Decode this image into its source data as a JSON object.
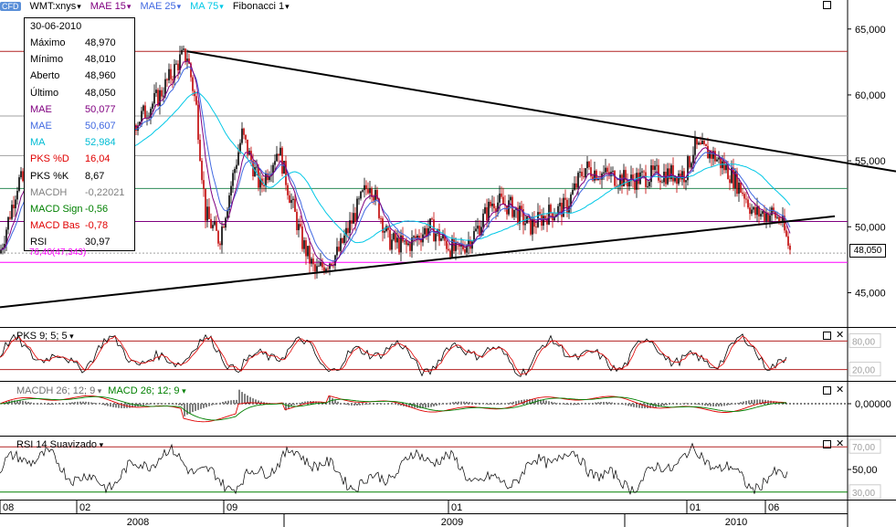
{
  "header": {
    "logo": "CFD",
    "symbol": "WMT:xnys",
    "indicators": [
      {
        "label": "MAE 15",
        "color": "#800080"
      },
      {
        "label": "MAE 25",
        "color": "#4169e1"
      },
      {
        "label": "MA 75",
        "color": "#00c8e6"
      },
      {
        "label": "Fibonacci 1",
        "color": "#000000"
      }
    ]
  },
  "info_box": {
    "date": "30-06-2010",
    "rows": [
      {
        "key": "Máximo",
        "value": "48,970",
        "color": "#000000"
      },
      {
        "key": "Mínimo",
        "value": "48,010",
        "color": "#000000"
      },
      {
        "key": "Aberto",
        "value": "48,960",
        "color": "#000000"
      },
      {
        "key": "Último",
        "value": "48,050",
        "color": "#000000"
      },
      {
        "key": "MAE",
        "value": "50,077",
        "color": "#800080"
      },
      {
        "key": "MAE",
        "value": "50,607",
        "color": "#4169e1"
      },
      {
        "key": "MA",
        "value": "52,984",
        "color": "#00bcd4"
      },
      {
        "key": "PKS %D",
        "value": "16,04",
        "color": "#e00000"
      },
      {
        "key": "PKS %K",
        "value": "8,67",
        "color": "#000000"
      },
      {
        "key": "MACDH",
        "value": "-0,22021",
        "color": "#808080"
      },
      {
        "key": "MACD Sign",
        "value": "-0,56",
        "color": "#008000"
      },
      {
        "key": "MACD Bas",
        "value": "-0,78",
        "color": "#e00000"
      },
      {
        "key": "RSI",
        "value": "30,97",
        "color": "#000000"
      }
    ]
  },
  "fib_label": "76,40(47,343)",
  "price_badge": "48,050",
  "panels": {
    "stoch_title": "PKS 9; 5; 5",
    "macdh_title": "MACDH 26; 12; 9",
    "macd_title": "MACD 26; 12; 9",
    "rsi_title": "RSI 14 Suavizado"
  },
  "chart_data": [
    {
      "type": "candlestick",
      "title": "WMT:xnys",
      "y_ticks": [
        "65,000",
        "60,000",
        "55,000",
        "50,000",
        "45,000"
      ],
      "ylim": [
        42.4,
        67.2
      ],
      "x_month_ticks": [
        "08",
        "02",
        "09",
        "01",
        "01",
        "06"
      ],
      "x_year_labels": [
        "2008",
        "2009",
        "2010"
      ],
      "last_price": 48.05,
      "horizontal_levels": [
        {
          "value": 63.3,
          "color": "#b22222"
        },
        {
          "value": 58.4,
          "color": "#a0a0a0"
        },
        {
          "value": 55.4,
          "color": "#a0a0a0"
        },
        {
          "value": 52.9,
          "color": "#2e8b57"
        },
        {
          "value": 50.4,
          "color": "#800080"
        },
        {
          "value": 48.0,
          "color": "#a0a0a0"
        },
        {
          "value": 47.3,
          "color": "#ff00ff"
        }
      ],
      "trendlines": [
        {
          "from": [
            205,
            63.3
          ],
          "to": [
            981,
            54.2
          ]
        },
        {
          "from": [
            0,
            43.9
          ],
          "to": [
            914,
            50.8
          ]
        }
      ]
    },
    {
      "type": "line",
      "title": "PKS 9; 5; 5",
      "y_ticks": [
        "80,00",
        "20,00"
      ],
      "ylim": [
        0,
        100
      ],
      "levels": [
        80,
        20
      ]
    },
    {
      "type": "bar",
      "title": "MACDH 26; 12; 9",
      "y_ticks": [
        "0,00000"
      ],
      "zero_line": 0
    },
    {
      "type": "line",
      "title": "RSI 14 Suavizado",
      "y_ticks": [
        "70,00",
        "50,00",
        "30,00"
      ],
      "ylim": [
        25,
        75
      ],
      "levels": [
        70,
        30
      ]
    }
  ],
  "colors": {
    "up": "#000000",
    "down": "#c00000",
    "mae15": "#800080",
    "mae25": "#4169e1",
    "ma75": "#00c8e6"
  }
}
